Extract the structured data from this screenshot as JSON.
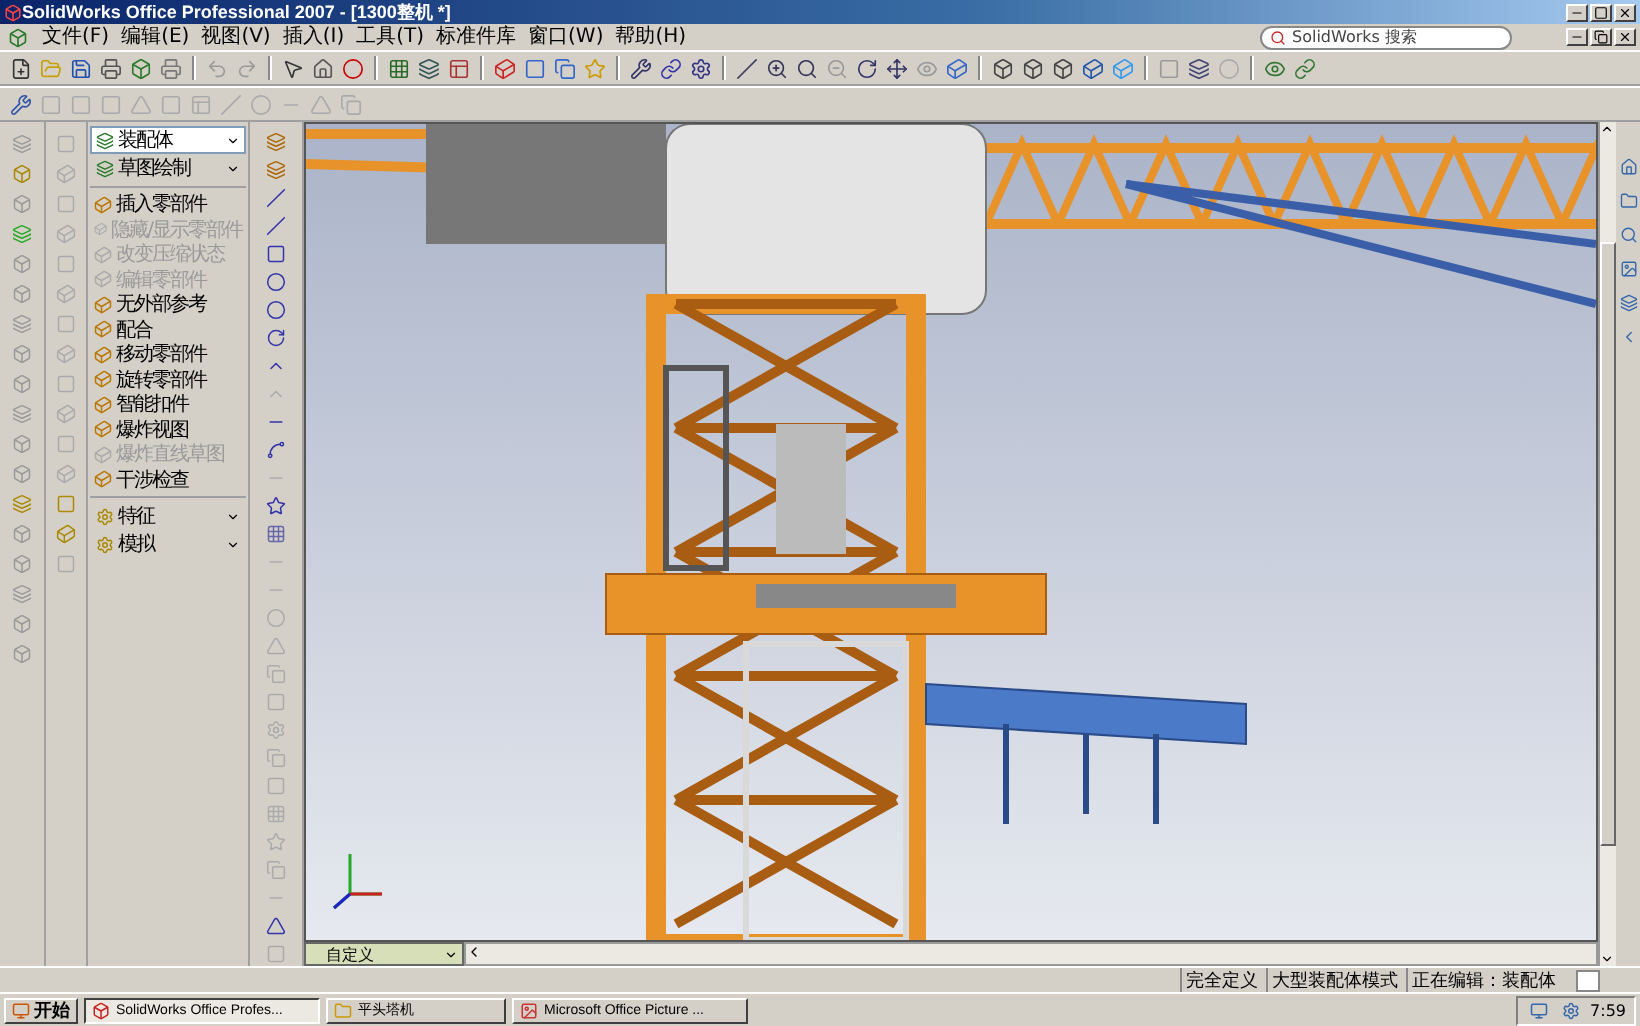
{
  "window": {
    "title": "SolidWorks Office Professional 2007 - [1300整机 *]"
  },
  "menu": [
    "文件(F)",
    "编辑(E)",
    "视图(V)",
    "插入(I)",
    "工具(T)",
    "标准件库",
    "窗口(W)",
    "帮助(H)"
  ],
  "search": {
    "placeholder": "SolidWorks 搜索"
  },
  "command_manager": {
    "groups": [
      {
        "label": "装配体",
        "selected": true
      },
      {
        "label": "草图绘制",
        "selected": false
      }
    ],
    "tools": [
      {
        "label": "插入零部件",
        "disabled": false
      },
      {
        "label": "隐藏/显示零部件",
        "disabled": true
      },
      {
        "label": "改变压缩状态",
        "disabled": true
      },
      {
        "label": "编辑零部件",
        "disabled": true
      },
      {
        "label": "无外部参考",
        "disabled": false
      },
      {
        "label": "配合",
        "disabled": false
      },
      {
        "label": "移动零部件",
        "disabled": false
      },
      {
        "label": "旋转零部件",
        "disabled": false
      },
      {
        "label": "智能扣件",
        "disabled": false
      },
      {
        "label": "爆炸视图",
        "disabled": false
      },
      {
        "label": "爆炸直线草图",
        "disabled": true
      },
      {
        "label": "干涉检查",
        "disabled": false
      }
    ],
    "bottom_groups": [
      {
        "label": "特征",
        "selected": false
      },
      {
        "label": "模拟",
        "selected": false
      }
    ]
  },
  "configuration": {
    "value": "自定义"
  },
  "status_bar": [
    "完全定义",
    "大型装配体模式",
    "正在编辑：装配体"
  ],
  "taskbar": {
    "start": "开始",
    "tasks": [
      {
        "label": "SolidWorks Office Profes...",
        "selected": true
      },
      {
        "label": "平头塔机",
        "selected": false
      },
      {
        "label": "Microsoft Office Picture ...",
        "selected": false
      }
    ],
    "clock": "7:59"
  }
}
